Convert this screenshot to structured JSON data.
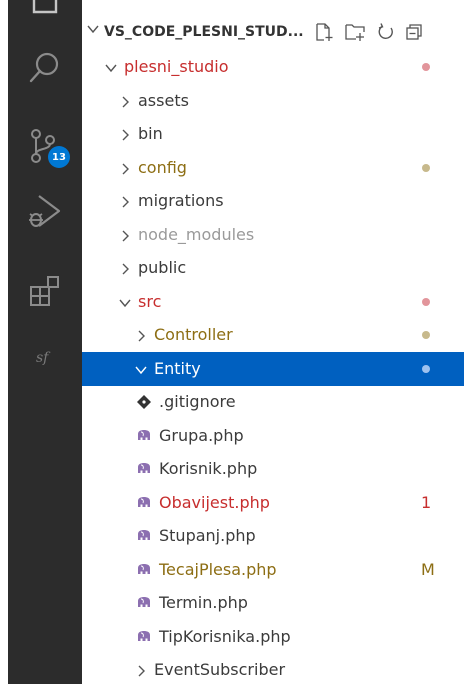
{
  "explorer": {
    "title": "VS_CODE_PLESNI_STUD...",
    "buttons": [
      {
        "name": "new-file-icon"
      },
      {
        "name": "new-folder-icon"
      },
      {
        "name": "refresh-icon"
      },
      {
        "name": "collapse-all-icon"
      }
    ]
  },
  "activity_bar": {
    "items": [
      {
        "name": "explorer-icon"
      },
      {
        "name": "search-icon"
      },
      {
        "name": "source-control-icon",
        "badge": "13"
      },
      {
        "name": "run-debug-icon"
      },
      {
        "name": "extensions-icon"
      },
      {
        "name": "symfony-icon"
      }
    ]
  },
  "tree": [
    {
      "label": "plesni_studio",
      "kind": "folder",
      "open": true,
      "depth": 1,
      "color": "#c72e2e",
      "decoration": {
        "type": "dot",
        "color": "#e2959b"
      }
    },
    {
      "label": "assets",
      "kind": "folder",
      "open": false,
      "depth": 2,
      "color": "#3b3b3b"
    },
    {
      "label": "bin",
      "kind": "folder",
      "open": false,
      "depth": 2,
      "color": "#3b3b3b"
    },
    {
      "label": "config",
      "kind": "folder",
      "open": false,
      "depth": 2,
      "color": "#8d6e14",
      "decoration": {
        "type": "dot",
        "color": "#c7b98c"
      }
    },
    {
      "label": "migrations",
      "kind": "folder",
      "open": false,
      "depth": 2,
      "color": "#3b3b3b"
    },
    {
      "label": "node_modules",
      "kind": "folder",
      "open": false,
      "depth": 2,
      "color": "#9a9a9a"
    },
    {
      "label": "public",
      "kind": "folder",
      "open": false,
      "depth": 2,
      "color": "#3b3b3b"
    },
    {
      "label": "src",
      "kind": "folder",
      "open": true,
      "depth": 2,
      "color": "#c72e2e",
      "decoration": {
        "type": "dot",
        "color": "#e2959b"
      }
    },
    {
      "label": "Controller",
      "kind": "folder",
      "open": false,
      "depth": 3,
      "color": "#8d6e14",
      "decoration": {
        "type": "dot",
        "color": "#c7b98c"
      }
    },
    {
      "label": "Entity",
      "kind": "folder",
      "open": true,
      "depth": 3,
      "color": "#ffffff",
      "selected": true,
      "decoration": {
        "type": "dot",
        "color": "#9ec2ef"
      }
    },
    {
      "label": ".gitignore",
      "kind": "file",
      "icon": "git-diamond-icon",
      "depth": 4,
      "color": "#3b3b3b"
    },
    {
      "label": "Grupa.php",
      "kind": "file",
      "icon": "php-elephant-icon",
      "depth": 4,
      "color": "#3b3b3b"
    },
    {
      "label": "Korisnik.php",
      "kind": "file",
      "icon": "php-elephant-icon",
      "depth": 4,
      "color": "#3b3b3b"
    },
    {
      "label": "Obavijest.php",
      "kind": "file",
      "icon": "php-elephant-icon",
      "depth": 4,
      "color": "#c72e2e",
      "decoration": {
        "type": "text",
        "text": "1",
        "color": "#c72e2e"
      }
    },
    {
      "label": "Stupanj.php",
      "kind": "file",
      "icon": "php-elephant-icon",
      "depth": 4,
      "color": "#3b3b3b"
    },
    {
      "label": "TecajPlesa.php",
      "kind": "file",
      "icon": "php-elephant-icon",
      "depth": 4,
      "color": "#8d6e14",
      "decoration": {
        "type": "text",
        "text": "M",
        "color": "#8d6e14"
      }
    },
    {
      "label": "Termin.php",
      "kind": "file",
      "icon": "php-elephant-icon",
      "depth": 4,
      "color": "#3b3b3b"
    },
    {
      "label": "TipKorisnika.php",
      "kind": "file",
      "icon": "php-elephant-icon",
      "depth": 4,
      "color": "#3b3b3b"
    },
    {
      "label": "EventSubscriber",
      "kind": "folder",
      "open": false,
      "depth": 3,
      "color": "#3b3b3b"
    }
  ],
  "colors": {
    "activity_bar_bg": "#2c2c2c",
    "activity_icon": "#8b8b8b",
    "selection_bg": "#0060c0",
    "badge_bg": "#0078d4",
    "php_icon": "#8c6fb0"
  }
}
